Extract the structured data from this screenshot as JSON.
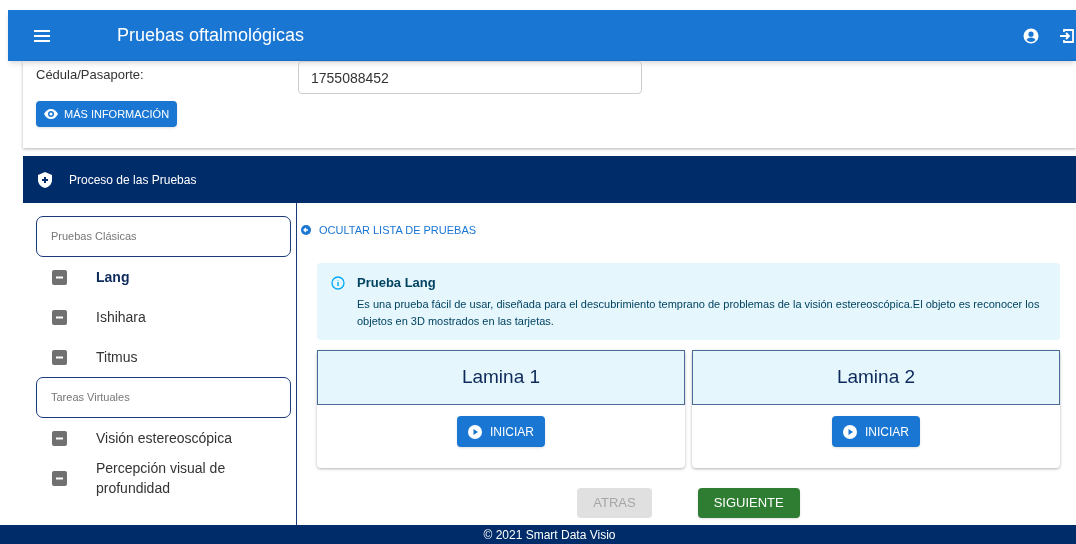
{
  "app_bar": {
    "title": "Pruebas oftalmológicas"
  },
  "patient": {
    "label": "Cédula/Pasaporte:",
    "value": "1755088452",
    "info_button": "MÁS INFORMACIÓN"
  },
  "section": {
    "title": "Proceso de las Pruebas"
  },
  "sidebar": {
    "groups": [
      {
        "label": "Pruebas Clásicas",
        "items": [
          {
            "label": "Lang",
            "selected": true
          },
          {
            "label": "Ishihara",
            "selected": false
          },
          {
            "label": "Titmus",
            "selected": false
          }
        ]
      },
      {
        "label": "Tareas Virtuales",
        "items": [
          {
            "label": "Visión estereoscópica",
            "selected": false
          },
          {
            "label": "Percepción visual de profundidad",
            "selected": false
          }
        ]
      }
    ]
  },
  "hide_list_link": "OCULTAR LISTA DE PRUEBAS",
  "info_alert": {
    "title": "Prueba Lang",
    "text": "Es una prueba fácil de usar, diseñada para el descubrimiento temprano de problemas de la visión estereoscópica.El objeto es reconocer los objetos en 3D mostrados en las tarjetas."
  },
  "plates": [
    {
      "title": "Lamina 1",
      "button": "INICIAR"
    },
    {
      "title": "Lamina 2",
      "button": "INICIAR"
    }
  ],
  "nav": {
    "back": {
      "label": "ATRAS",
      "disabled": true
    },
    "next": {
      "label": "SIGUIENTE",
      "disabled": false
    }
  },
  "footer": "© 2021 Smart Data Visio"
}
